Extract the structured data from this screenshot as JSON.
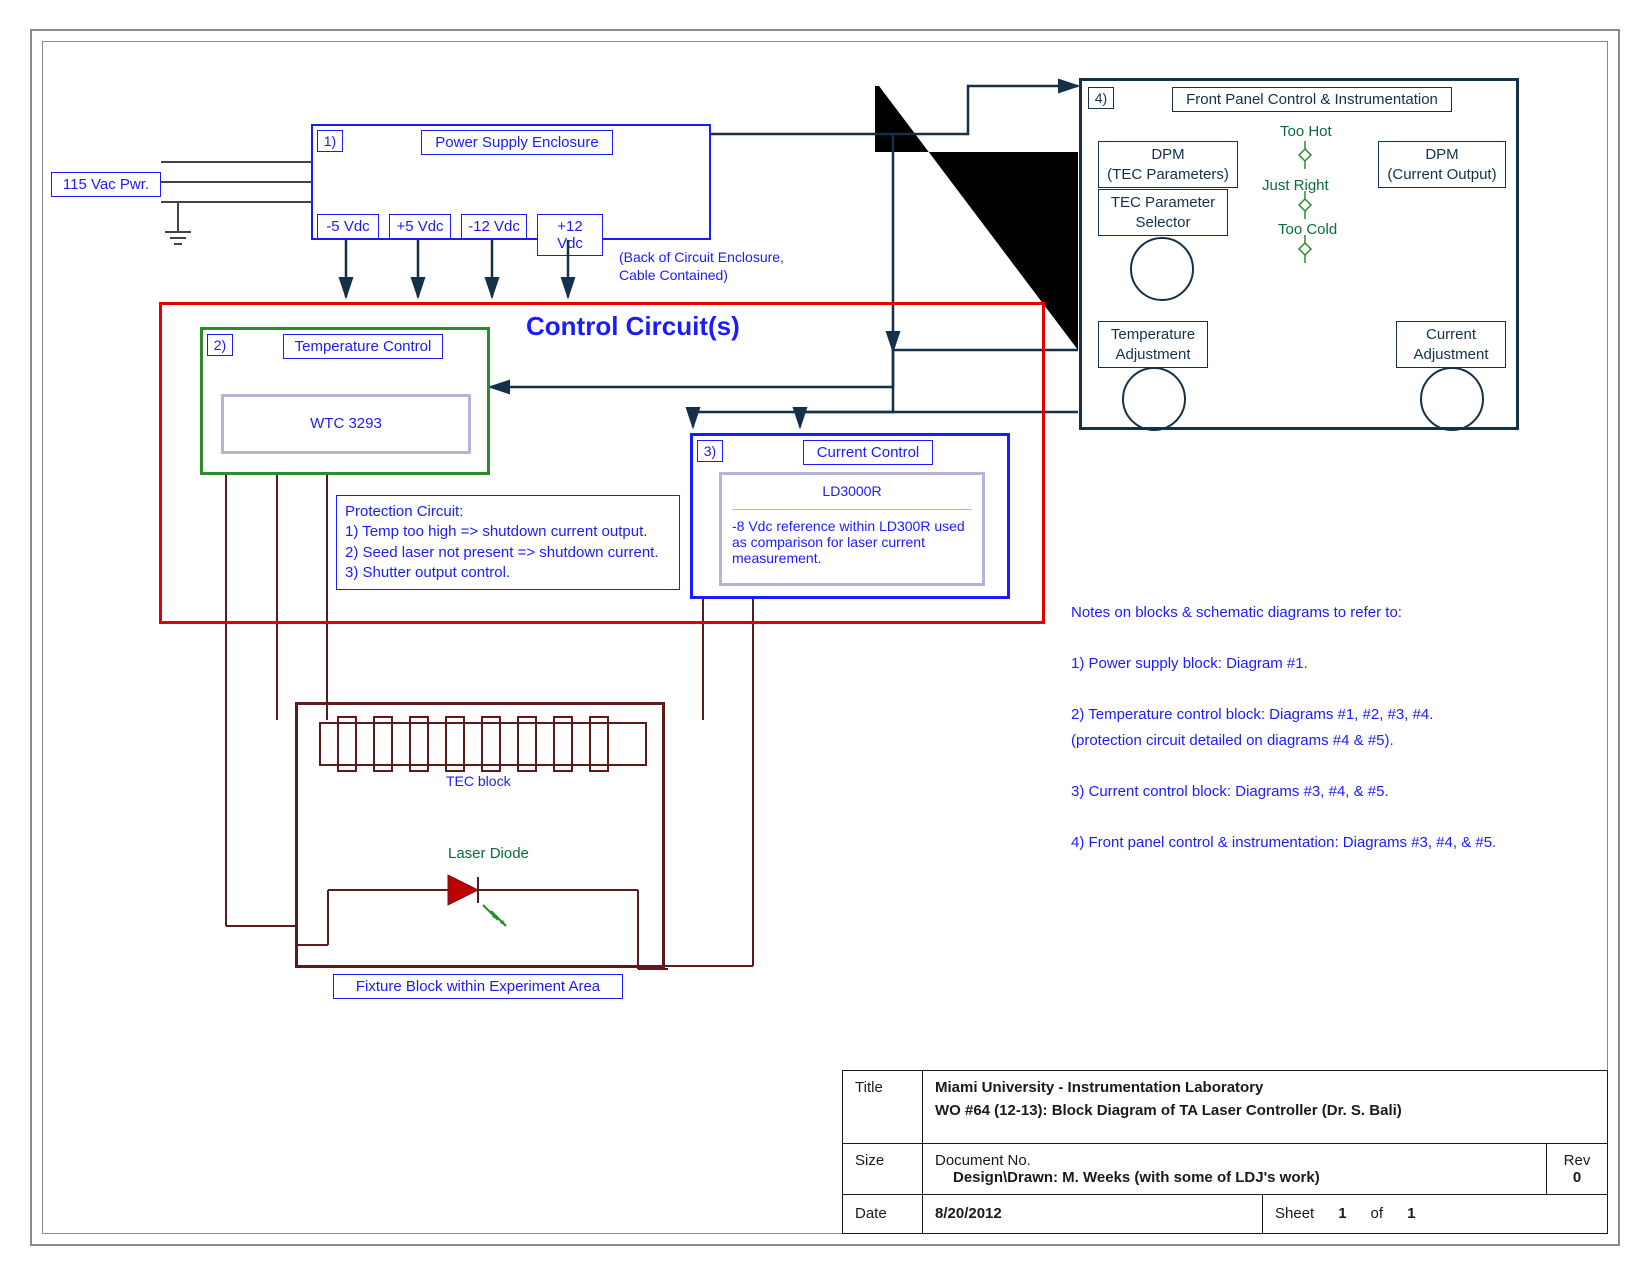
{
  "input_power": "115 Vac Pwr.",
  "power_supply": {
    "num": "1)",
    "title": "Power Supply Enclosure",
    "outputs": [
      "-5 Vdc",
      "+5 Vdc",
      "-12 Vdc",
      "+12 Vdc"
    ],
    "note": "(Back of Circuit Enclosure,\nCable Contained)"
  },
  "control_circuits": {
    "title": "Control Circuit(s)",
    "temp": {
      "num": "2)",
      "title": "Temperature Control",
      "chip": "WTC 3293",
      "protection_title": "Protection Circuit:",
      "protection_1": "1) Temp too high => shutdown current output.",
      "protection_2": "2) Seed laser not present => shutdown current.",
      "protection_3": "3) Shutter output control."
    },
    "current": {
      "num": "3)",
      "title": "Current Control",
      "chip": "LD3000R",
      "chip_note": "-8 Vdc reference within LD300R used as comparison for laser current measurement."
    }
  },
  "fixture": {
    "tec": "TEC block",
    "laser": "Laser Diode",
    "title": "Fixture Block within Experiment Area"
  },
  "front_panel": {
    "num": "4)",
    "title": "Front Panel Control & Instrumentation",
    "dpm_tec": "DPM\n(TEC Parameters)",
    "dpm_cur": "DPM\n(Current Output)",
    "selector": "TEC Parameter\nSelector",
    "too_hot": "Too Hot",
    "just_right": "Just Right",
    "too_cold": "Too Cold",
    "temp_adj": "Temperature\nAdjustment",
    "cur_adj": "Current\nAdjustment"
  },
  "notes": {
    "heading": "Notes on blocks & schematic diagrams to refer to:",
    "n1": "1) Power supply block: Diagram #1.",
    "n2": "2) Temperature control block: Diagrams #1, #2, #3, #4.",
    "n2b": "(protection circuit detailed on diagrams #4 & #5).",
    "n3": "3) Current control block: Diagrams #3, #4, & #5.",
    "n4": "4) Front panel control & instrumentation: Diagrams #3, #4, & #5."
  },
  "titleblock": {
    "title_hdr": "Title",
    "title_l1": "Miami University - Instrumentation Laboratory",
    "title_l2": "WO #64 (12-13): Block Diagram of TA Laser Controller (Dr. S. Bali)",
    "size_hdr": "Size",
    "doc_hdr": "Document No.",
    "doc_val": "Design\\Drawn: M. Weeks (with some of LDJ's work)",
    "rev_hdr": "Rev",
    "rev_val": "0",
    "date_hdr": "Date",
    "date_val": "8/20/2012",
    "sheet_hdr": "Sheet",
    "sheet_cur": "1",
    "sheet_of": "of",
    "sheet_tot": "1"
  }
}
